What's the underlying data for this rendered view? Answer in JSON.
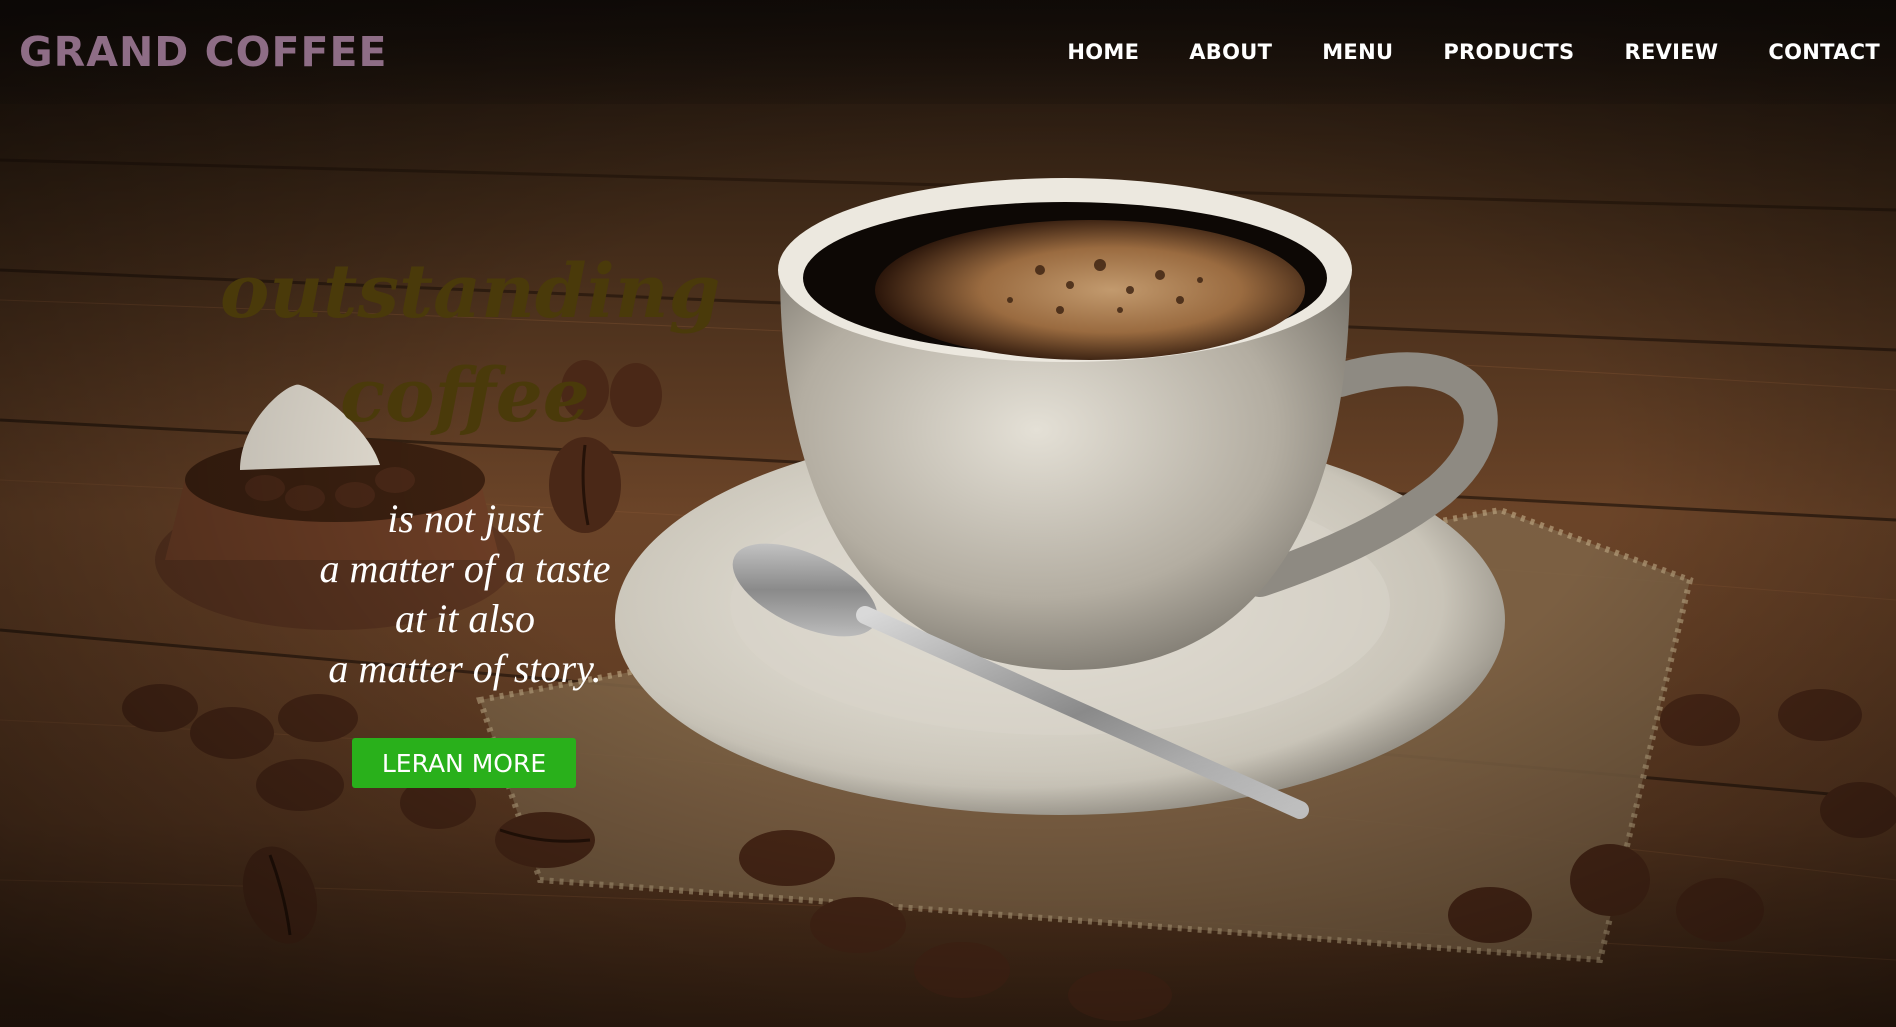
{
  "brand": {
    "name": "GRAND COFFEE"
  },
  "nav": {
    "items": [
      {
        "label": "HOME"
      },
      {
        "label": "ABOUT"
      },
      {
        "label": "MENU"
      },
      {
        "label": "PRODUCTS"
      },
      {
        "label": "REVIEW"
      },
      {
        "label": "CONTACT"
      }
    ]
  },
  "hero": {
    "headline_line1": "outstanding",
    "headline_line2": "coffee",
    "tagline_lines": [
      "is not just",
      "a matter of a taste",
      "at it also",
      "a matter of story."
    ],
    "cta_label": "LERAN MORE"
  },
  "colors": {
    "brand": "#8e6d86",
    "headline": "#4a3a0a",
    "cta_bg": "#29b01b",
    "nav_text": "#ffffff"
  },
  "icons": {
    "background": "coffee-cup-photo"
  }
}
